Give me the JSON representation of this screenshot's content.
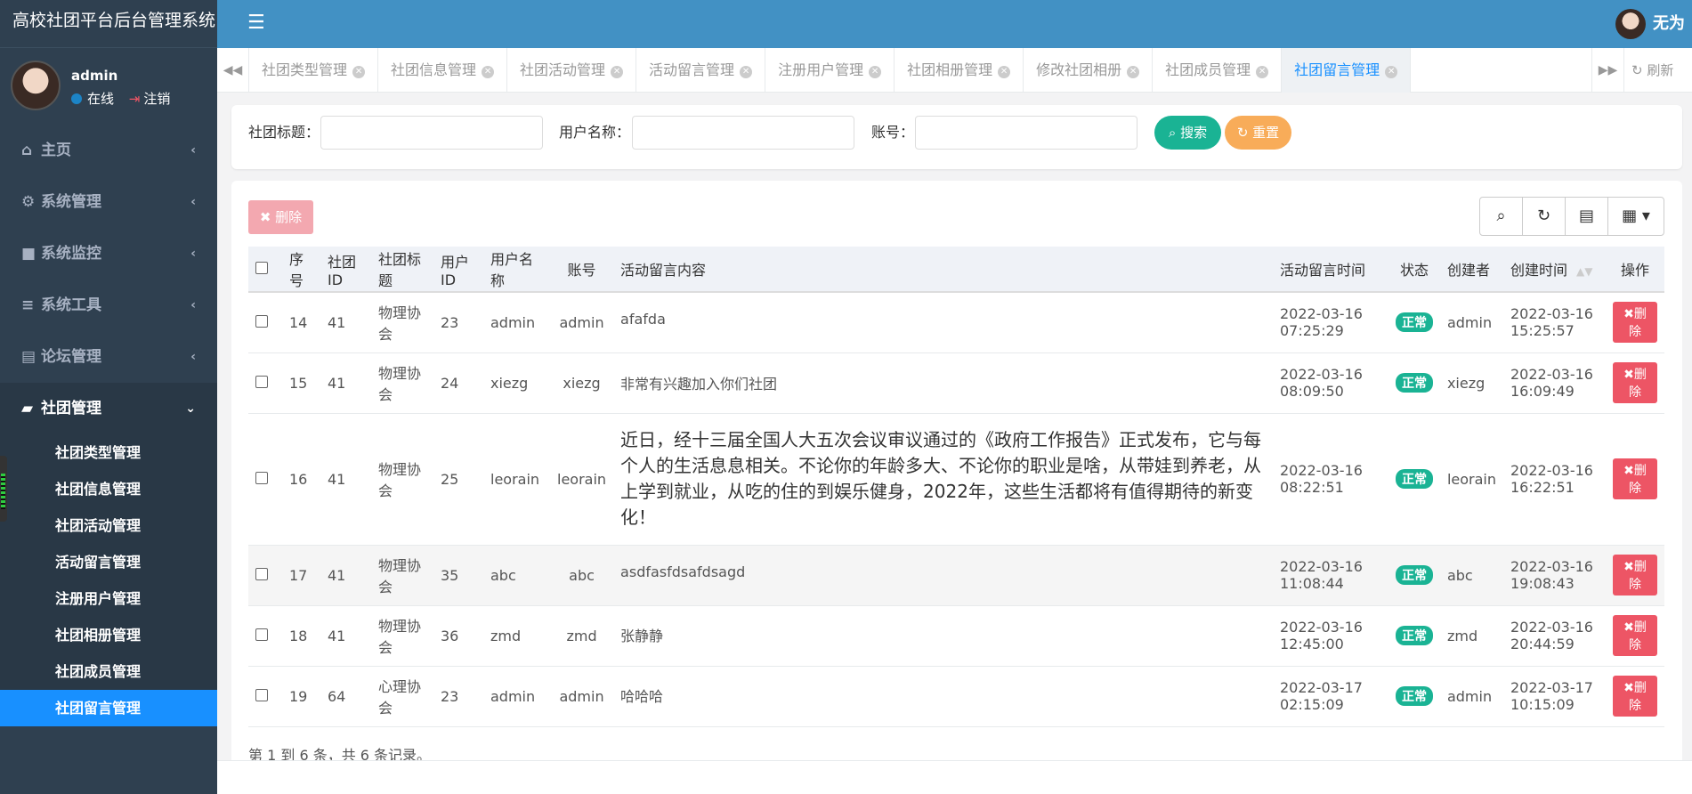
{
  "app": {
    "title": "高校社团平台后台管理系统"
  },
  "profile": {
    "name": "admin",
    "status": "在线",
    "logout": "注销"
  },
  "header": {
    "user_name": "无为"
  },
  "sidebar": {
    "items": [
      {
        "label": "主页",
        "icon": "home-icon"
      },
      {
        "label": "系统管理",
        "icon": "gear-icon"
      },
      {
        "label": "系统监控",
        "icon": "video-icon"
      },
      {
        "label": "系统工具",
        "icon": "bars-icon"
      },
      {
        "label": "论坛管理",
        "icon": "id-card-icon"
      },
      {
        "label": "社团管理",
        "icon": "car-icon"
      }
    ],
    "submenu": [
      "社团类型管理",
      "社团信息管理",
      "社团活动管理",
      "活动留言管理",
      "注册用户管理",
      "社团相册管理",
      "社团成员管理",
      "社团留言管理"
    ]
  },
  "tabs": [
    "社团类型管理",
    "社团信息管理",
    "社团活动管理",
    "活动留言管理",
    "注册用户管理",
    "社团相册管理",
    "修改社团相册",
    "社团成员管理",
    "社团留言管理"
  ],
  "tab_refresh": "刷新",
  "search": {
    "title_label": "社团标题：",
    "username_label": "用户名称：",
    "account_label": "账号：",
    "search_btn": "搜索",
    "reset_btn": "重置"
  },
  "toolbar": {
    "delete_btn": "删除"
  },
  "table": {
    "headers": [
      "序号",
      "社团ID",
      "社团标题",
      "用户ID",
      "用户名称",
      "账号",
      "活动留言内容",
      "活动留言时间",
      "状态",
      "创建者",
      "创建时间",
      "操作"
    ],
    "rows": [
      {
        "no": "14",
        "club_id": "41",
        "club_title": "物理协会",
        "user_id": "23",
        "user_name": "admin",
        "account": "admin",
        "content": "afafda",
        "msg_time_date": "2022-03-16",
        "msg_time_clock": "07:25:29",
        "status": "正常",
        "creator": "admin",
        "create_date": "2022-03-16",
        "create_clock": "15:25:57",
        "action": "删除"
      },
      {
        "no": "15",
        "club_id": "41",
        "club_title": "物理协会",
        "user_id": "24",
        "user_name": "xiezg",
        "account": "xiezg",
        "content": "非常有兴趣加入你们社团",
        "msg_time_date": "2022-03-16",
        "msg_time_clock": "08:09:50",
        "status": "正常",
        "creator": "xiezg",
        "create_date": "2022-03-16",
        "create_clock": "16:09:49",
        "action": "删除"
      },
      {
        "no": "16",
        "club_id": "41",
        "club_title": "物理协会",
        "user_id": "25",
        "user_name": "leorain",
        "account": "leorain",
        "content": "近日，经十三届全国人大五次会议审议通过的《政府工作报告》正式发布，它与每个人的生活息息相关。不论你的年龄多大、不论你的职业是啥，从带娃到养老，从上学到就业，从吃的住的到娱乐健身，2022年，这些生活都将有值得期待的新变化！",
        "msg_time_date": "2022-03-16",
        "msg_time_clock": "08:22:51",
        "status": "正常",
        "creator": "leorain",
        "create_date": "2022-03-16",
        "create_clock": "16:22:51",
        "action": "删除"
      },
      {
        "no": "17",
        "club_id": "41",
        "club_title": "物理协会",
        "user_id": "35",
        "user_name": "abc",
        "account": "abc",
        "content": "asdfasfdsafdsagd",
        "msg_time_date": "2022-03-16",
        "msg_time_clock": "11:08:44",
        "status": "正常",
        "creator": "abc",
        "create_date": "2022-03-16",
        "create_clock": "19:08:43",
        "action": "删除"
      },
      {
        "no": "18",
        "club_id": "41",
        "club_title": "物理协会",
        "user_id": "36",
        "user_name": "zmd",
        "account": "zmd",
        "content": "张静静",
        "msg_time_date": "2022-03-16",
        "msg_time_clock": "12:45:00",
        "status": "正常",
        "creator": "zmd",
        "create_date": "2022-03-16",
        "create_clock": "20:44:59",
        "action": "删除"
      },
      {
        "no": "19",
        "club_id": "64",
        "club_title": "心理协会",
        "user_id": "23",
        "user_name": "admin",
        "account": "admin",
        "content": "哈哈哈",
        "msg_time_date": "2022-03-17",
        "msg_time_clock": "02:15:09",
        "status": "正常",
        "creator": "admin",
        "create_date": "2022-03-17",
        "create_clock": "10:15:09",
        "action": "删除"
      }
    ],
    "footer": "第 1 到 6 条，共 6 条记录。"
  },
  "colors": {
    "sidebar": "#2f4050",
    "topbar": "#4291c4",
    "accent": "#1890ff",
    "success": "#1ab394",
    "warning": "#f8ac59",
    "danger": "#ed5565"
  }
}
